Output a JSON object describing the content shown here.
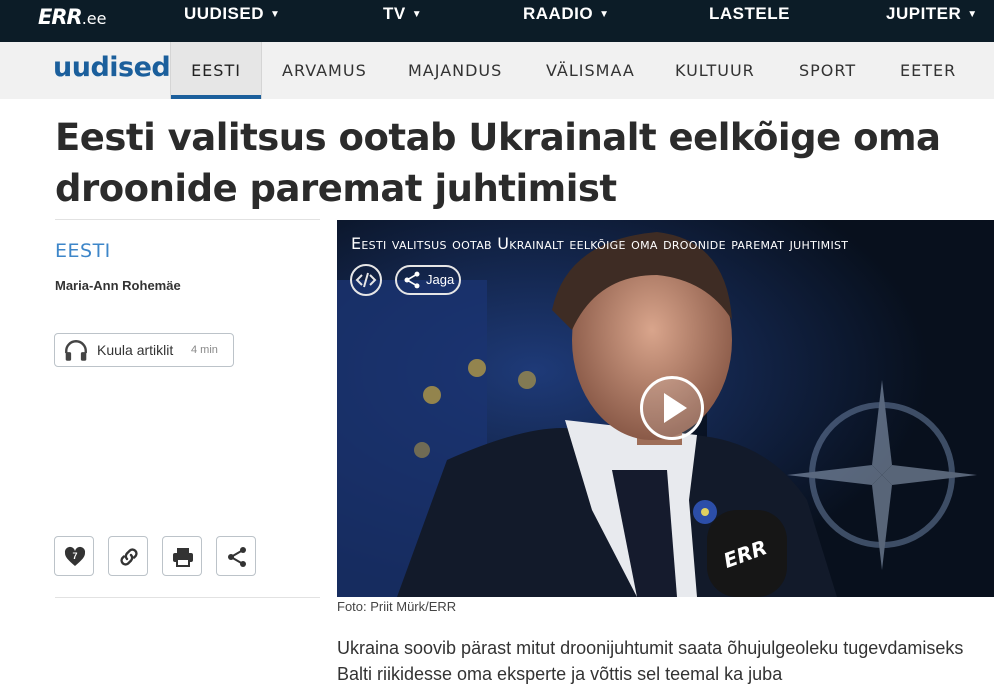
{
  "topbar": {
    "logo_main": "ERR",
    "logo_suffix": ".ee",
    "items": [
      {
        "label": "UUDISED",
        "caret": "▼"
      },
      {
        "label": "TV",
        "caret": "▼"
      },
      {
        "label": "RAADIO",
        "caret": "▼"
      },
      {
        "label": "LASTELE",
        "caret": ""
      },
      {
        "label": "JUPITER",
        "caret": "▼"
      }
    ]
  },
  "subnav": {
    "brand": "uudised",
    "tabs": [
      {
        "label": "EESTI",
        "active": true
      },
      {
        "label": "ARVAMUS"
      },
      {
        "label": "MAJANDUS"
      },
      {
        "label": "VÄLISMAA"
      },
      {
        "label": "KULTUUR"
      },
      {
        "label": "SPORT"
      },
      {
        "label": "EETER"
      }
    ]
  },
  "article": {
    "headline": "Eesti valitsus ootab Ukrainalt eelkõige oma droonide paremat juhtimist",
    "category": "EESTI",
    "author": "Maria-Ann Rohemäe",
    "listen_label": "Kuula artiklit",
    "listen_duration": "4 min",
    "like_count": "7",
    "photo_caption": "Foto: Priit Mürk/ERR",
    "lead": "Ukraina soovib pärast mitut droonijuhtumit saata õhujulgeoleku tugevdamiseks Balti riikidesse oma eksperte ja võttis sel teemal ka juba"
  },
  "video": {
    "title": "Eesti valitsus ootab Ukrainalt eelkõige oma droonide paremat juhtimist",
    "share_label": "Jaga",
    "mic_logo": "ERR"
  },
  "colors": {
    "topbar_bg": "#0c1c27",
    "brand_blue": "#1b5f9c",
    "category_blue": "#3d86c9",
    "subnav_bg": "#f1f1f1"
  },
  "icons": [
    "headphones-icon",
    "heart-icon",
    "link-icon",
    "print-icon",
    "share-icon",
    "embed-code-icon",
    "play-icon"
  ]
}
